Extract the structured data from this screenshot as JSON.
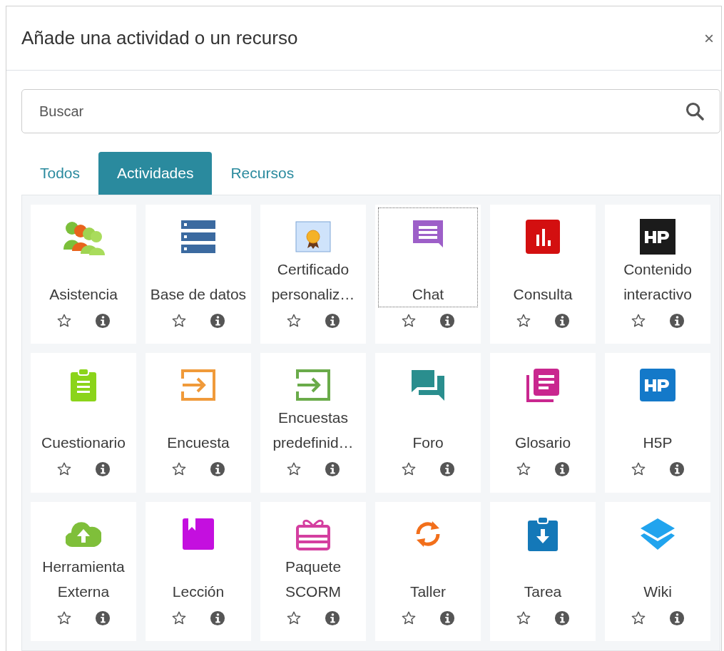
{
  "dialog": {
    "title": "Añade una actividad o un recurso",
    "close": "×"
  },
  "search": {
    "placeholder": "Buscar"
  },
  "tabs": [
    {
      "label": "Todos",
      "selected": false
    },
    {
      "label": "Actividades",
      "selected": true
    },
    {
      "label": "Recursos",
      "selected": false
    }
  ],
  "items": [
    {
      "label": "Asistencia",
      "starred": false,
      "focused": false
    },
    {
      "label": "Base de datos",
      "starred": false,
      "focused": false
    },
    {
      "label": "Certificado personaliz…",
      "starred": false,
      "focused": false
    },
    {
      "label": "Chat",
      "starred": false,
      "focused": true
    },
    {
      "label": "Consulta",
      "starred": false,
      "focused": false
    },
    {
      "label": "Contenido interactivo",
      "starred": false,
      "focused": false
    },
    {
      "label": "Cuestionario",
      "starred": false,
      "focused": false
    },
    {
      "label": "Encuesta",
      "starred": false,
      "focused": false
    },
    {
      "label": "Encuestas predefinid…",
      "starred": false,
      "focused": false
    },
    {
      "label": "Foro",
      "starred": false,
      "focused": false
    },
    {
      "label": "Glosario",
      "starred": false,
      "focused": false
    },
    {
      "label": "H5P",
      "starred": false,
      "focused": false
    },
    {
      "label": "Herramienta Externa",
      "starred": false,
      "focused": false
    },
    {
      "label": "Lección",
      "starred": false,
      "focused": false
    },
    {
      "label": "Paquete SCORM",
      "starred": false,
      "focused": false
    },
    {
      "label": "Taller",
      "starred": false,
      "focused": false
    },
    {
      "label": "Tarea",
      "starred": false,
      "focused": false
    },
    {
      "label": "Wiki",
      "starred": false,
      "focused": false
    }
  ]
}
